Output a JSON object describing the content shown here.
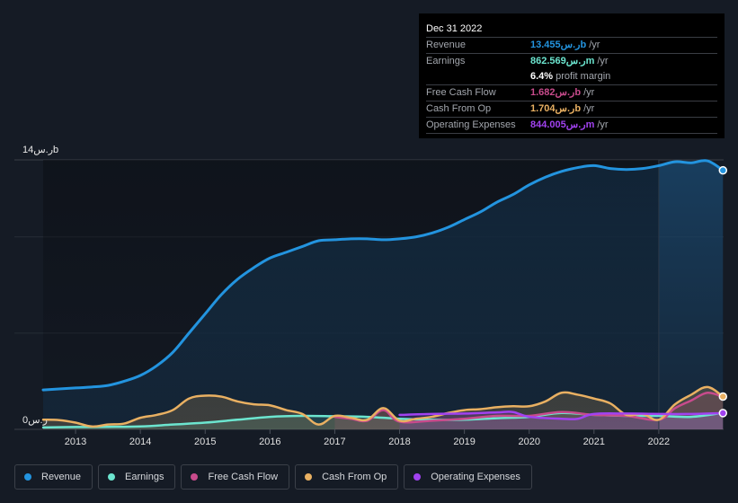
{
  "tooltip": {
    "date": "Dec 31 2022",
    "rows": [
      {
        "label": "Revenue",
        "value": "13.455ر.سb",
        "unit": "/yr",
        "color": "#2394df"
      },
      {
        "label": "Earnings",
        "value": "862.569ر.سm",
        "unit": "/yr",
        "color": "#6ce5cf"
      },
      {
        "label": "",
        "sub_value": "6.4%",
        "sub_text": "profit margin"
      },
      {
        "label": "Free Cash Flow",
        "value": "1.682ر.سb",
        "unit": "/yr",
        "color": "#c84b8c"
      },
      {
        "label": "Cash From Op",
        "value": "1.704ر.سb",
        "unit": "/yr",
        "color": "#e9b062"
      },
      {
        "label": "Operating Expenses",
        "value": "844.005ر.سm",
        "unit": "/yr",
        "color": "#a142f0"
      }
    ]
  },
  "legend": [
    {
      "label": "Revenue",
      "color": "#2394df"
    },
    {
      "label": "Earnings",
      "color": "#6ce5cf"
    },
    {
      "label": "Free Cash Flow",
      "color": "#c84b8c"
    },
    {
      "label": "Cash From Op",
      "color": "#e9b062"
    },
    {
      "label": "Operating Expenses",
      "color": "#a142f0"
    }
  ],
  "chart_data": {
    "type": "area",
    "title": "",
    "xlabel": "",
    "ylabel": "",
    "y_top_label": "14ر.سb",
    "y_bottom_label": "0ر.س",
    "ylim": [
      0,
      14
    ],
    "xlim": [
      2012.5,
      2023.0
    ],
    "x_ticks": [
      "2013",
      "2014",
      "2015",
      "2016",
      "2017",
      "2018",
      "2019",
      "2020",
      "2021",
      "2022"
    ],
    "gridlines": [
      0,
      5,
      10,
      14
    ],
    "highlight_from": 2022.0,
    "legend_position": "bottom-left",
    "series": [
      {
        "name": "Revenue",
        "color": "#2394df",
        "unit": "b",
        "x": [
          2012.5,
          2013.0,
          2013.25,
          2013.5,
          2013.75,
          2014.0,
          2014.25,
          2014.5,
          2014.75,
          2015.0,
          2015.25,
          2015.5,
          2015.75,
          2016.0,
          2016.25,
          2016.5,
          2016.75,
          2017.0,
          2017.25,
          2017.5,
          2017.75,
          2018.0,
          2018.25,
          2018.5,
          2018.75,
          2019.0,
          2019.25,
          2019.5,
          2019.75,
          2020.0,
          2020.25,
          2020.5,
          2020.75,
          2021.0,
          2021.25,
          2021.5,
          2021.75,
          2022.0,
          2022.25,
          2022.5,
          2022.75,
          2022.99
        ],
        "values": [
          2.05,
          2.15,
          2.2,
          2.28,
          2.5,
          2.8,
          3.3,
          4.0,
          5.0,
          6.0,
          7.0,
          7.8,
          8.4,
          8.9,
          9.2,
          9.5,
          9.8,
          9.85,
          9.9,
          9.9,
          9.85,
          9.9,
          10.0,
          10.2,
          10.5,
          10.9,
          11.3,
          11.8,
          12.2,
          12.7,
          13.1,
          13.4,
          13.6,
          13.7,
          13.55,
          13.5,
          13.55,
          13.7,
          13.9,
          13.85,
          13.95,
          13.455
        ]
      },
      {
        "name": "Earnings",
        "color": "#6ce5cf",
        "unit": "b",
        "x": [
          2012.5,
          2013.0,
          2013.5,
          2014.0,
          2014.5,
          2015.0,
          2015.5,
          2016.0,
          2016.5,
          2017.0,
          2017.5,
          2018.0,
          2018.5,
          2019.0,
          2019.5,
          2020.0,
          2020.5,
          2021.0,
          2021.5,
          2022.0,
          2022.5,
          2022.99
        ],
        "values": [
          0.1,
          0.12,
          0.13,
          0.15,
          0.25,
          0.35,
          0.5,
          0.65,
          0.7,
          0.68,
          0.65,
          0.55,
          0.5,
          0.5,
          0.58,
          0.65,
          0.85,
          0.75,
          0.7,
          0.7,
          0.65,
          0.86
        ]
      },
      {
        "name": "Free Cash Flow",
        "color": "#c84b8c",
        "unit": "b",
        "x": [
          2017.0,
          2017.25,
          2017.5,
          2017.75,
          2018.0,
          2018.5,
          2019.0,
          2019.5,
          2020.0,
          2020.5,
          2021.0,
          2021.5,
          2022.0,
          2022.25,
          2022.5,
          2022.75,
          2022.99
        ],
        "values": [
          0.65,
          0.55,
          0.45,
          1.0,
          0.4,
          0.45,
          0.55,
          0.7,
          0.7,
          0.9,
          0.75,
          0.7,
          0.5,
          1.1,
          1.5,
          1.9,
          1.682
        ]
      },
      {
        "name": "Cash From Op",
        "color": "#e9b062",
        "unit": "b",
        "x": [
          2012.5,
          2012.75,
          2013.0,
          2013.25,
          2013.5,
          2013.75,
          2014.0,
          2014.25,
          2014.5,
          2014.75,
          2015.0,
          2015.25,
          2015.5,
          2015.75,
          2016.0,
          2016.25,
          2016.5,
          2016.75,
          2017.0,
          2017.25,
          2017.5,
          2017.75,
          2018.0,
          2018.25,
          2018.5,
          2018.75,
          2019.0,
          2019.25,
          2019.5,
          2019.75,
          2020.0,
          2020.25,
          2020.5,
          2020.75,
          2021.0,
          2021.25,
          2021.5,
          2021.75,
          2022.0,
          2022.25,
          2022.5,
          2022.75,
          2022.99
        ],
        "values": [
          0.5,
          0.48,
          0.35,
          0.15,
          0.25,
          0.3,
          0.6,
          0.75,
          1.0,
          1.6,
          1.75,
          1.7,
          1.45,
          1.3,
          1.25,
          1.0,
          0.8,
          0.25,
          0.7,
          0.6,
          0.5,
          1.1,
          0.45,
          0.55,
          0.65,
          0.85,
          1.0,
          1.05,
          1.15,
          1.2,
          1.2,
          1.45,
          1.9,
          1.8,
          1.6,
          1.35,
          0.75,
          0.8,
          0.5,
          1.3,
          1.8,
          2.2,
          1.704
        ]
      },
      {
        "name": "Operating Expenses",
        "color": "#a142f0",
        "unit": "b",
        "x": [
          2018.0,
          2018.5,
          2019.0,
          2019.5,
          2019.75,
          2020.0,
          2020.5,
          2020.75,
          2021.0,
          2021.5,
          2022.0,
          2022.5,
          2022.99
        ],
        "values": [
          0.75,
          0.8,
          0.82,
          0.88,
          0.9,
          0.65,
          0.55,
          0.55,
          0.8,
          0.82,
          0.8,
          0.8,
          0.844
        ]
      }
    ]
  }
}
